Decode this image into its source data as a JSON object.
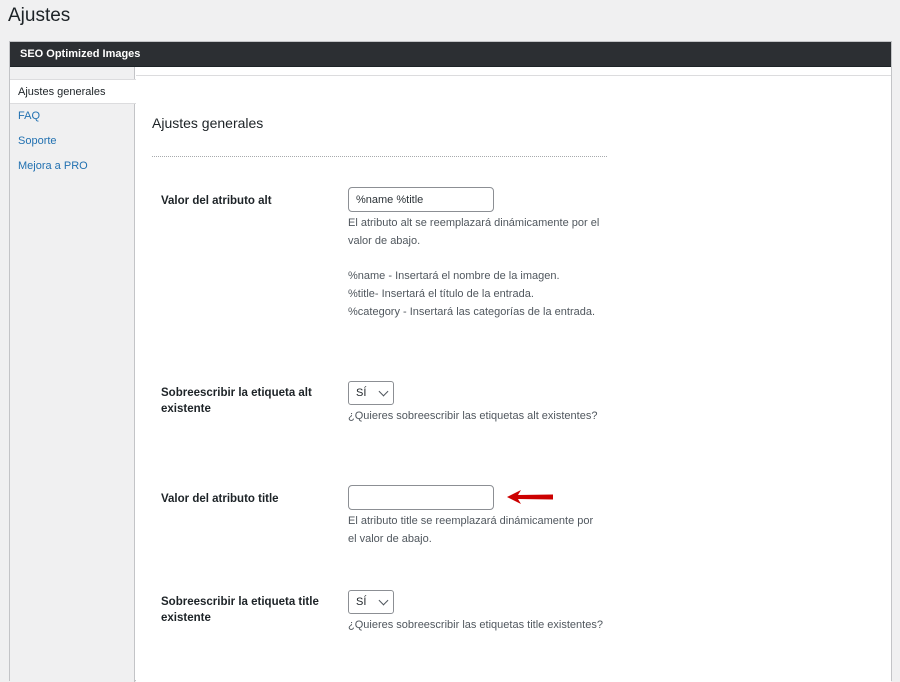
{
  "page": {
    "title": "Ajustes"
  },
  "plugin": {
    "header": "SEO Optimized Images"
  },
  "sidebar": {
    "items": [
      {
        "label": "Ajustes generales",
        "active": true
      },
      {
        "label": "FAQ",
        "active": false
      },
      {
        "label": "Soporte",
        "active": false
      },
      {
        "label": "Mejora a PRO",
        "active": false
      }
    ]
  },
  "main": {
    "section_title": "Ajustes generales",
    "alt_value": {
      "label": "Valor del atributo alt",
      "value": "%name %title",
      "desc1": "El atributo alt se reemplazará dinámicamente por el valor de abajo.",
      "help1": "%name - Insertará el nombre de la imagen.",
      "help2": "%title- Insertará el título de la entrada.",
      "help3": "%category - Insertará las categorías de la entrada."
    },
    "alt_override": {
      "label": "Sobreescribir la etiqueta alt existente",
      "selected": "SÍ",
      "desc": "¿Quieres sobreescribir las etiquetas alt existentes?"
    },
    "title_value": {
      "label": "Valor del atributo title",
      "value": "",
      "desc": "El atributo title se reemplazará dinámicamente por el valor de abajo."
    },
    "title_override": {
      "label": "Sobreescribir la etiqueta title existente",
      "selected": "SÍ",
      "desc": "¿Quieres sobreescribir las etiquetas title existentes?"
    }
  },
  "colors": {
    "accent": "#2271b1",
    "arrow": "#cc0000",
    "header_bg": "#2c2f33"
  }
}
